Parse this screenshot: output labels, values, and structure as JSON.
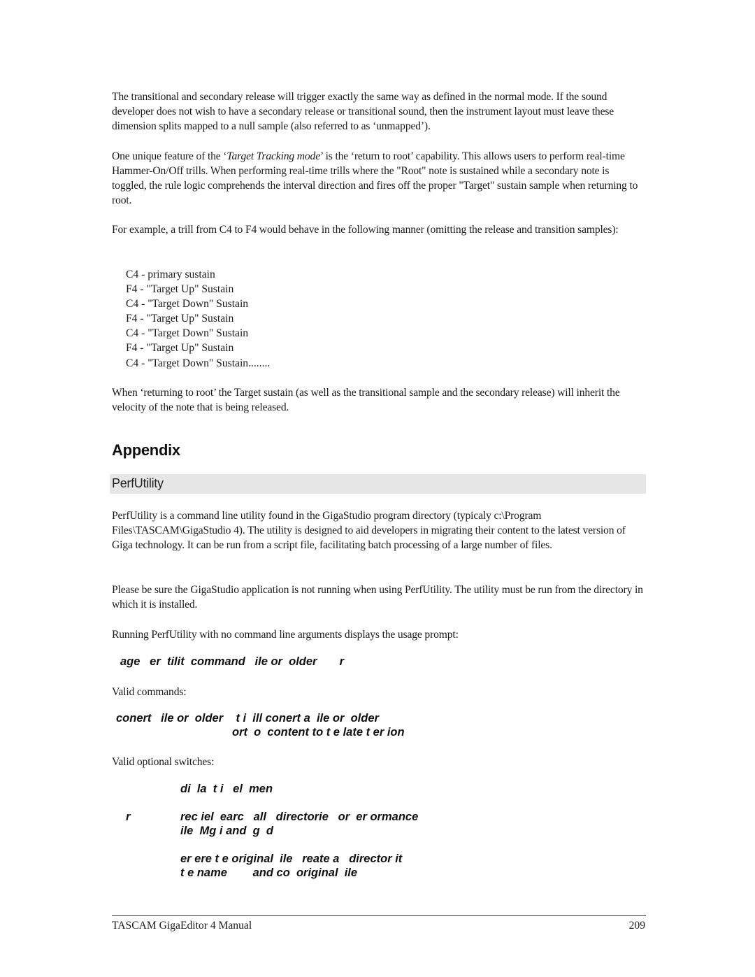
{
  "paragraphs": {
    "p1": "The transitional and secondary release will trigger exactly the same way as defined in the normal mode. If the sound developer does not wish to have a secondary release or transitional sound, then the instrument layout must leave these dimension splits mapped to a null sample (also referred to as ‘unmapped’).",
    "p2_before": "One unique feature of the ‘",
    "p2_italic": "Target Tracking mode",
    "p2_after": "’  is the ‘return to root’ capability. This allows users to perform real-time Hammer-On/Off trills. When performing real-time trills where the \"Root\" note is sustained while a secondary note is toggled, the rule logic comprehends the interval direction and fires off the proper \"Target\" sustain sample when returning to root.",
    "p3": "For example, a trill from C4 to F4 would behave in the following manner (omitting the release and transition samples):",
    "p4": "When ‘returning to root’ the Target sustain (as well as the transitional sample and the secondary release) will inherit the velocity of the note that is being released."
  },
  "trill_list": [
    "C4 - primary sustain",
    "F4 - \"Target Up\" Sustain",
    "C4 - \"Target Down\" Sustain",
    "F4 - \"Target Up\" Sustain",
    "C4 - \"Target Down\" Sustain",
    "F4 - \"Target Up\" Sustain",
    "C4 - \"Target Down\" Sustain........"
  ],
  "appendix": {
    "heading": "Appendix",
    "section_title": "PerfUtility",
    "p1": "PerfUtility is a command line utility found in the GigaStudio program directory (typicaly c:\\Program Files\\TASCAM\\GigaStudio 4).  The utility is designed to aid developers in migrating their content to the latest version of Giga technology.  It can be run from a script file, facilitating batch processing of a large number of files.",
    "p2": "Please be sure the GigaStudio application is not running when using PerfUtility.  The utility must be run from the directory in which it is installed.",
    "p3": "Running PerfUtility with no command line arguments displays the usage prompt:",
    "usage_line": "age   er  tilit  command   ile or  older       r",
    "valid_commands_label": "Valid commands:",
    "command_line_1": "conert   ile or  older    t i  ill conert a  ile or  older",
    "command_line_2": "ort  o  content to t e late t er ion",
    "valid_switches_label": "Valid optional switches:",
    "switches": [
      {
        "flag": "",
        "desc_lines": [
          "di  la  t i   el  men"
        ]
      },
      {
        "flag": "r",
        "desc_lines": [
          "rec iel  earc   all   directorie   or  er ormance",
          "ile  Mg i and  g  d"
        ]
      },
      {
        "flag": "",
        "desc_lines": [
          "er ere t e original  ile   reate a   director it",
          "t e name        and co  original  ile"
        ]
      }
    ]
  },
  "footer": {
    "title": "TASCAM GigaEditor 4 Manual",
    "page_number": "209"
  }
}
